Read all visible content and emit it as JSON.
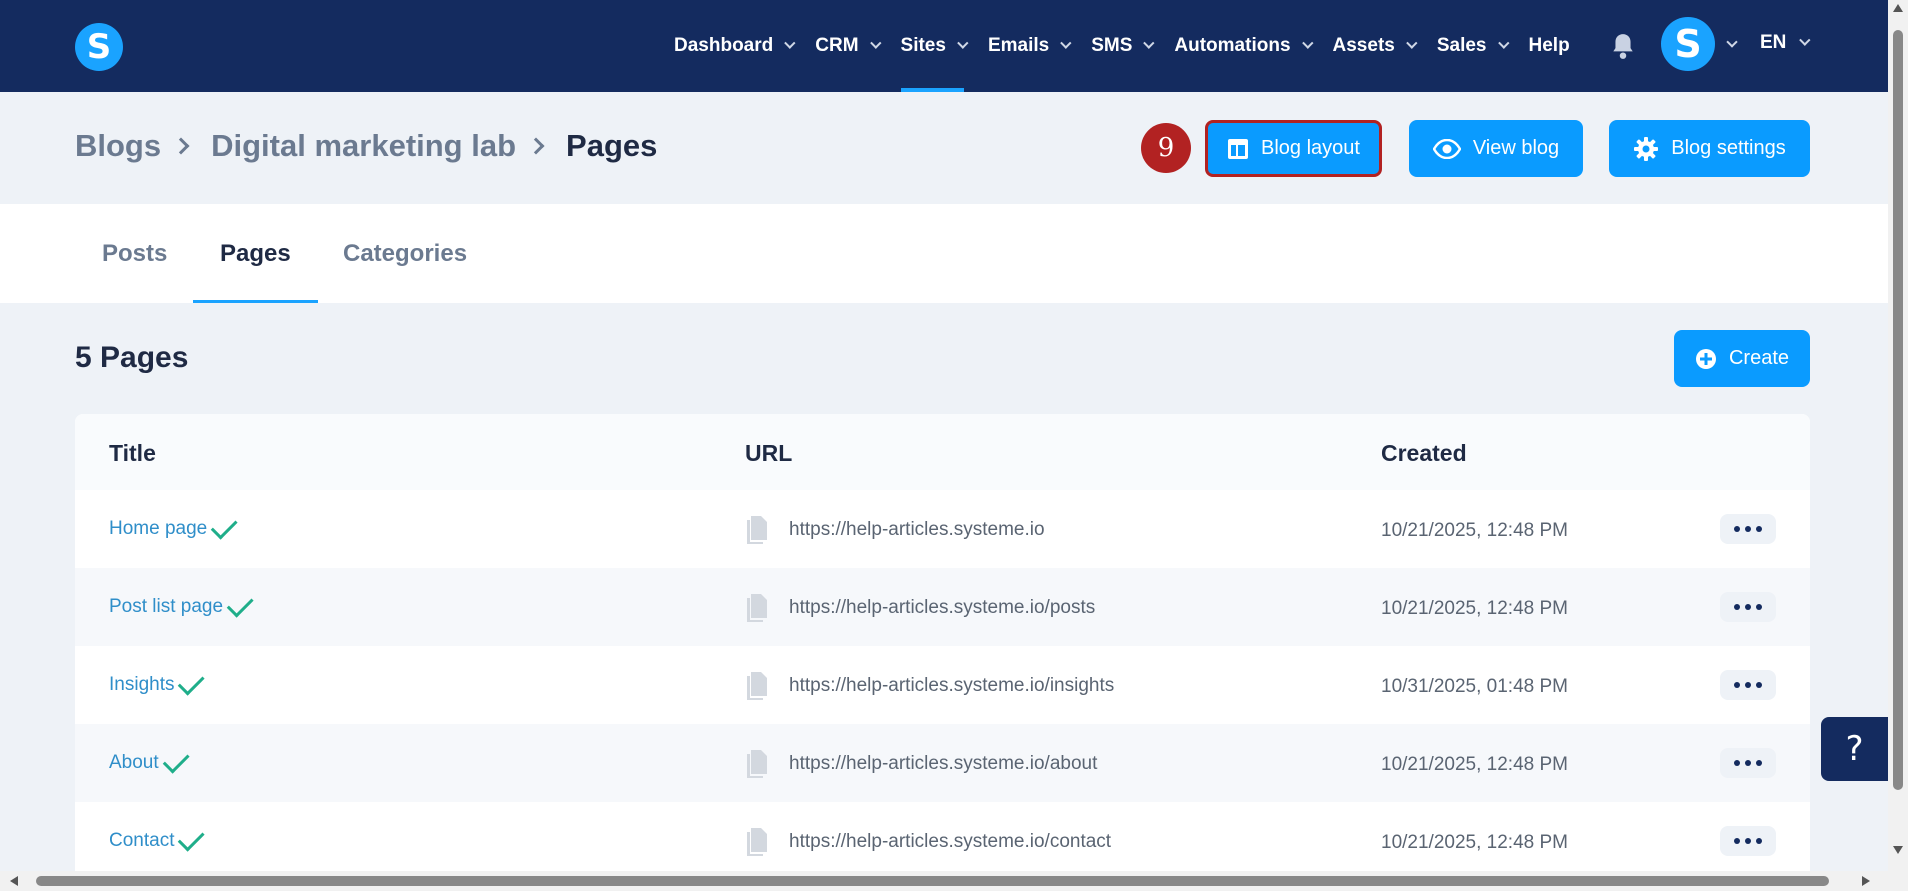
{
  "colors": {
    "nav_bg": "#142b5f",
    "accent": "#0a9bff",
    "highlight_border": "#b22222",
    "link": "#2f8ec9",
    "check": "#1fae8a"
  },
  "topnav": {
    "logo_letter": "S",
    "items": [
      {
        "label": "Dashboard",
        "has_dropdown": true,
        "active": false
      },
      {
        "label": "CRM",
        "has_dropdown": true,
        "active": false
      },
      {
        "label": "Sites",
        "has_dropdown": true,
        "active": true
      },
      {
        "label": "Emails",
        "has_dropdown": true,
        "active": false
      },
      {
        "label": "SMS",
        "has_dropdown": true,
        "active": false
      },
      {
        "label": "Automations",
        "has_dropdown": true,
        "active": false
      },
      {
        "label": "Assets",
        "has_dropdown": true,
        "active": false
      },
      {
        "label": "Sales",
        "has_dropdown": true,
        "active": false
      },
      {
        "label": "Help",
        "has_dropdown": false,
        "active": false
      }
    ],
    "bell_icon": "bell-icon",
    "avatar_letter": "S",
    "language": "EN"
  },
  "breadcrumb": {
    "items": [
      "Blogs",
      "Digital marketing lab",
      "Pages"
    ]
  },
  "header_actions": {
    "step_number": "9",
    "blog_layout_label": "Blog layout",
    "view_blog_label": "View blog",
    "blog_settings_label": "Blog settings"
  },
  "tabs": {
    "posts": "Posts",
    "pages": "Pages",
    "categories": "Categories",
    "active": "Pages"
  },
  "section": {
    "title": "5 Pages",
    "create_label": "Create"
  },
  "table": {
    "columns": [
      "Title",
      "URL",
      "Created"
    ],
    "rows": [
      {
        "title": "Home page",
        "url": "https://help-articles.systeme.io",
        "created": "10/21/2025, 12:48 PM"
      },
      {
        "title": "Post list page",
        "url": "https://help-articles.systeme.io/posts",
        "created": "10/21/2025, 12:48 PM"
      },
      {
        "title": "Insights",
        "url": "https://help-articles.systeme.io/insights",
        "created": "10/31/2025, 01:48 PM"
      },
      {
        "title": "About",
        "url": "https://help-articles.systeme.io/about",
        "created": "10/21/2025, 12:48 PM"
      },
      {
        "title": "Contact",
        "url": "https://help-articles.systeme.io/contact",
        "created": "10/21/2025, 12:48 PM"
      }
    ]
  },
  "help_button": "?"
}
